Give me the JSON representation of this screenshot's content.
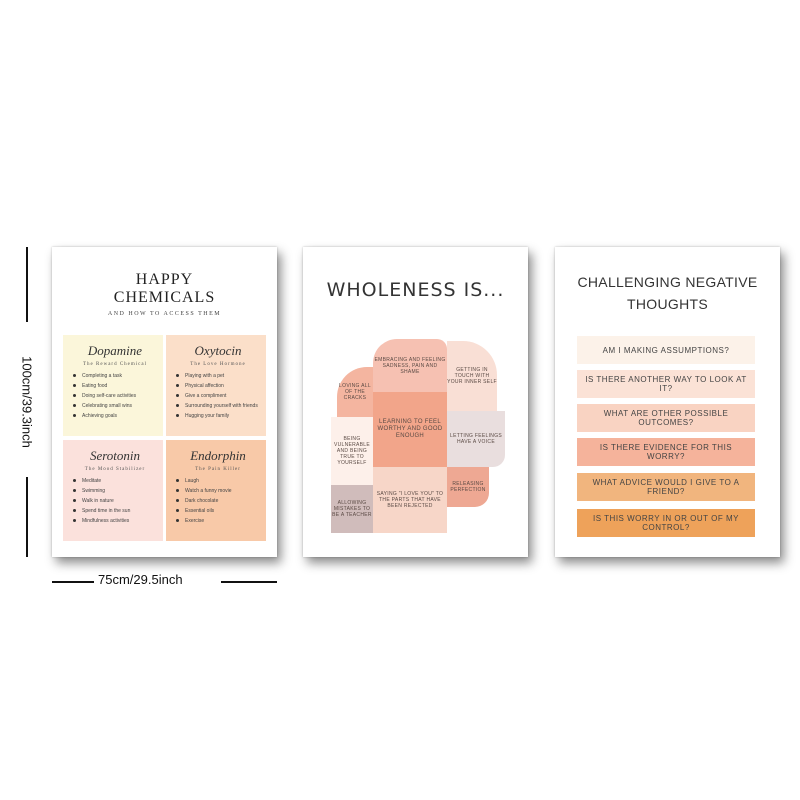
{
  "dimensions": {
    "width_label": "75cm/29.5inch",
    "height_label": "100cm/39.3inch"
  },
  "poster1": {
    "title_line1": "HAPPY",
    "title_line2": "CHEMICALS",
    "subtitle": "AND HOW TO ACCESS THEM",
    "chemicals": [
      {
        "name": "Dopamine",
        "tagline": "The Reward Chemical",
        "color": "#fbf6da",
        "items": [
          "Completing a task",
          "Eating food",
          "Doing self-care activities",
          "Celebrating small wins",
          "Achieving goals"
        ]
      },
      {
        "name": "Oxytocin",
        "tagline": "The Love Hormone",
        "color": "#fbdfc9",
        "items": [
          "Playing with a pet",
          "Physical affection",
          "Give a compliment",
          "Surrounding yourself with friends",
          "Hugging your family"
        ]
      },
      {
        "name": "Serotonin",
        "tagline": "The Mood Stabilizer",
        "color": "#fbe1dc",
        "items": [
          "Meditate",
          "Swimming",
          "Walk in nature",
          "Spend time in the sun",
          "Mindfulness activities"
        ]
      },
      {
        "name": "Endorphin",
        "tagline": "The Pain Killer",
        "color": "#f8c9a8",
        "items": [
          "Laugh",
          "Watch a funny movie",
          "Dark chocolate",
          "Essential oils",
          "Exercise"
        ]
      }
    ]
  },
  "poster2": {
    "title": "WHOLENESS IS...",
    "pieces": [
      {
        "text": "LOVING ALL OF THE CRACKS",
        "color": "#f4b5a0"
      },
      {
        "text": "EMBRACING AND FEELING SADNESS, PAIN AND SHAME",
        "color": "#f6c1b2"
      },
      {
        "text": "GETTING IN TOUCH WITH YOUR INNER SELF",
        "color": "#f9dfd5"
      },
      {
        "text": "BEING VULNERABLE AND BEING TRUE TO YOURSELF",
        "color": "#fdf0ea"
      },
      {
        "text": "LEARNING TO FEEL WORTHY AND GOOD ENOUGH",
        "color": "#f2a58a"
      },
      {
        "text": "LETTING FEELINGS HAVE A VOICE",
        "color": "#e9dede"
      },
      {
        "text": "ALLOWING MISTAKES TO BE A TEACHER",
        "color": "#d0bcbb"
      },
      {
        "text": "SAYING \"I LOVE YOU\" TO THE PARTS THAT HAVE BEEN REJECTED",
        "color": "#f7d6c8"
      },
      {
        "text": "RELEASING PERFECTION",
        "color": "#eea893"
      }
    ]
  },
  "poster3": {
    "title_line1": "CHALLENGING NEGATIVE",
    "title_line2": "THOUGHTS",
    "questions": [
      {
        "text": "AM I MAKING ASSUMPTIONS?",
        "color": "#fcf2e9"
      },
      {
        "text": "IS THERE ANOTHER WAY TO LOOK AT IT?",
        "color": "#fbe2d6"
      },
      {
        "text": "WHAT ARE OTHER POSSIBLE OUTCOMES?",
        "color": "#f9d3c2"
      },
      {
        "text": "IS THERE EVIDENCE FOR THIS WORRY?",
        "color": "#f5b39b"
      },
      {
        "text": "WHAT ADVICE WOULD I GIVE TO A FRIEND?",
        "color": "#f1b57e"
      },
      {
        "text": "IS THIS WORRY IN OR OUT OF MY CONTROL?",
        "color": "#eea25a"
      }
    ]
  }
}
